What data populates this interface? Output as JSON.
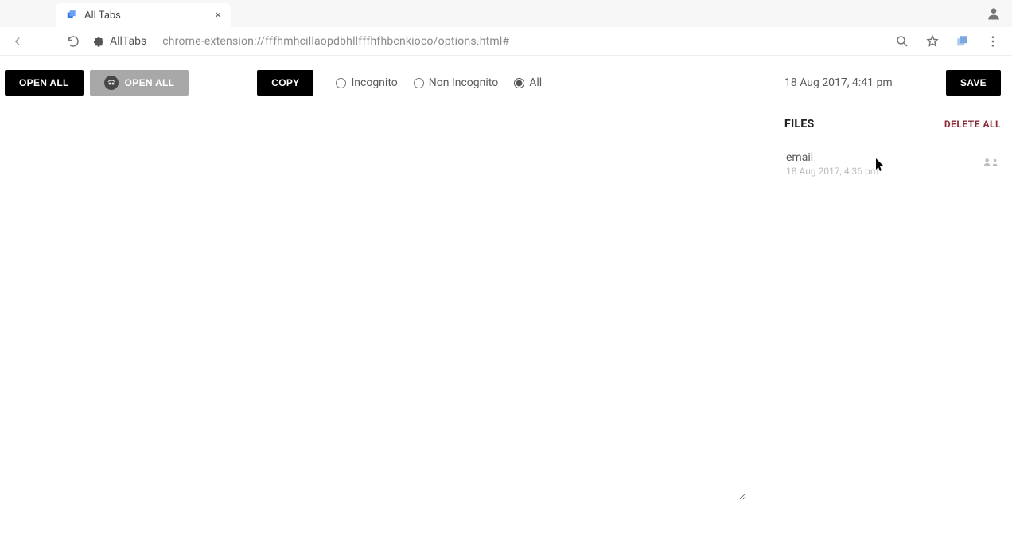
{
  "browser": {
    "tab_title": "All Tabs",
    "ext_name": "AllTabs",
    "url": "chrome-extension://fffhmhcillaopdbhllfffhfhbcnkioco/options.html#"
  },
  "actions": {
    "open_all": "OPEN ALL",
    "open_all_incognito": "OPEN ALL",
    "copy": "COPY",
    "save": "SAVE"
  },
  "filters": {
    "incognito": "Incognito",
    "non_incognito": "Non Incognito",
    "all": "All",
    "selected": "all"
  },
  "sidebar": {
    "current_time": "18 Aug 2017, 4:41 pm",
    "files_header": "FILES",
    "delete_all": "DELETE ALL",
    "files": [
      {
        "name": "email",
        "time": "18 Aug 2017, 4:36 pm"
      }
    ]
  }
}
